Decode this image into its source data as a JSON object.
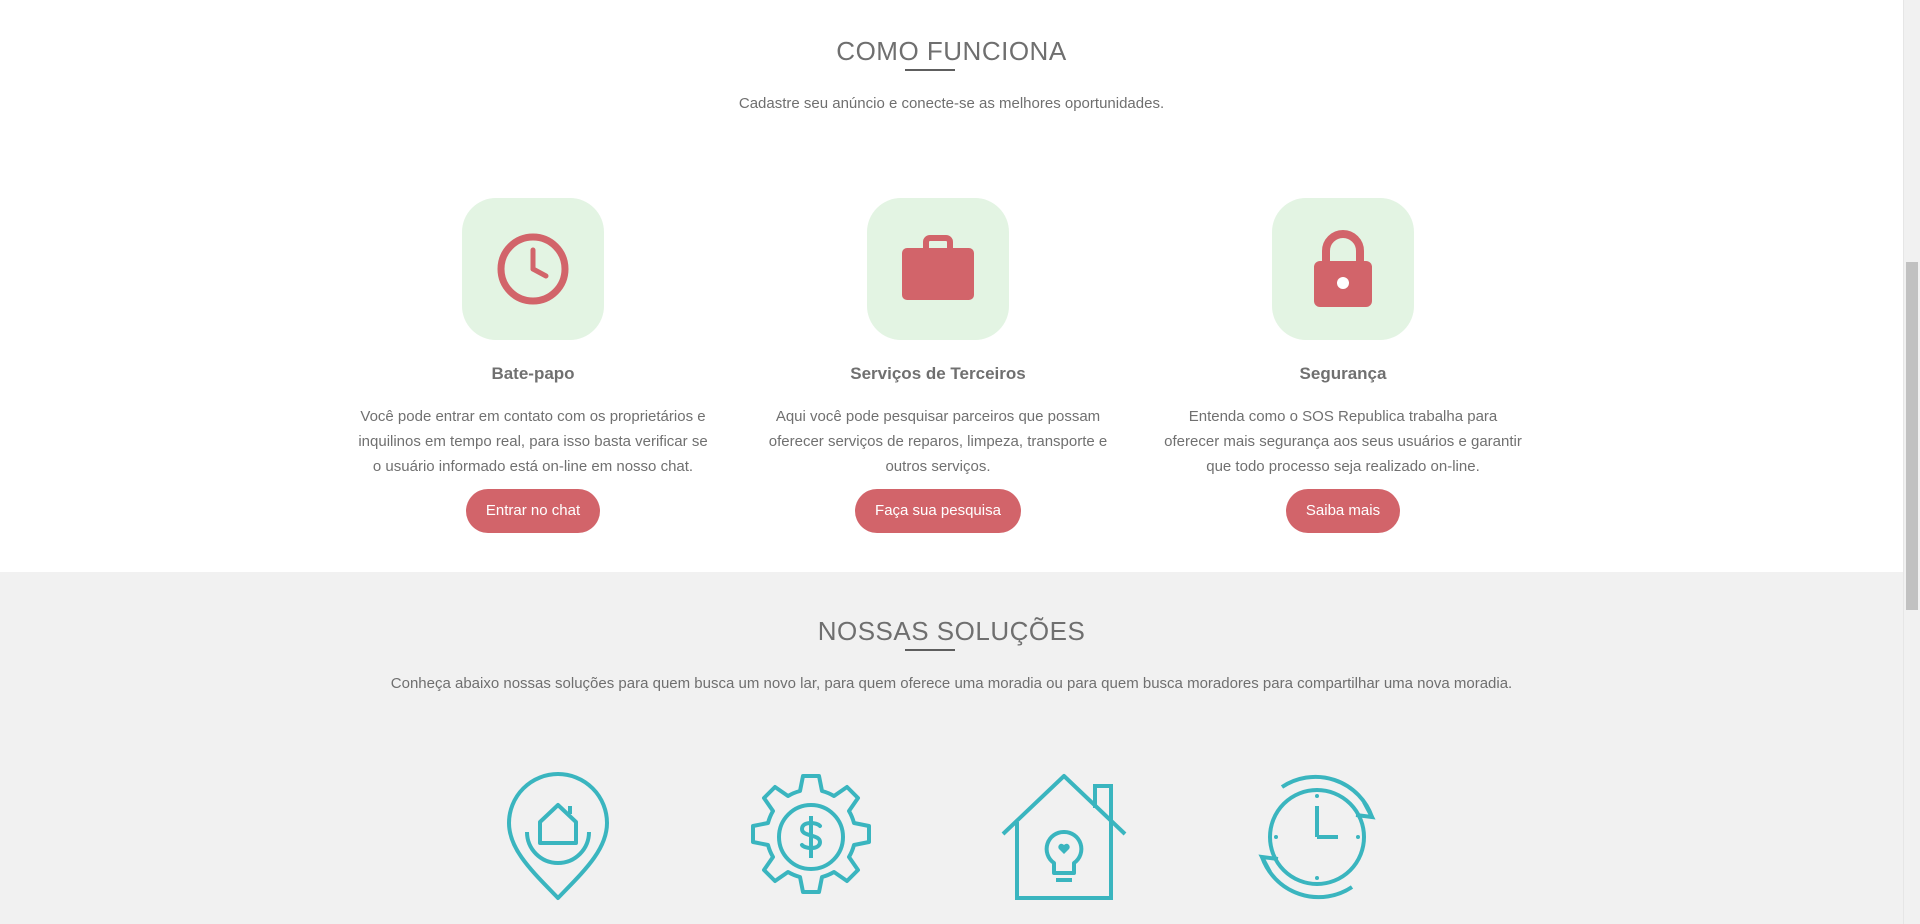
{
  "how_it_works": {
    "title": "COMO FUNCIONA",
    "subtitle": "Cadastre seu anúncio e conecte-se as melhores oportunidades.",
    "features": [
      {
        "icon": "clock-icon",
        "title": "Bate-papo",
        "text": "Você pode entrar em contato com os proprietários e inquilinos em tempo real, para isso basta verificar se o usuário informado está on-line em nosso chat.",
        "button": "Entrar no chat"
      },
      {
        "icon": "briefcase-icon",
        "title": "Serviços de Terceiros",
        "text": "Aqui você pode pesquisar parceiros que possam oferecer serviços de reparos, limpeza, transporte e outros serviços.",
        "button": "Faça sua pesquisa"
      },
      {
        "icon": "lock-icon",
        "title": "Segurança",
        "text": "Entenda como o SOS Republica trabalha para oferecer mais segurança aos seus usuários e garantir que todo processo seja realizado on-line.",
        "button": "Saiba mais"
      }
    ]
  },
  "solutions": {
    "title": "NOSSAS SOLUÇÕES",
    "subtitle": "Conheça abaixo nossas soluções para quem busca um novo lar, para quem oferece uma moradia ou para quem busca moradores para compartilhar uma nova moradia.",
    "icons": [
      "home-location-pin-icon",
      "gear-dollar-icon",
      "house-lightbulb-icon",
      "clock-refresh-icon"
    ]
  },
  "colors": {
    "accent": "#d2646a",
    "icon_box_bg": "#e3f4e3",
    "solution_icon": "#3ab5bf",
    "solutions_bg": "#f1f1f1"
  }
}
